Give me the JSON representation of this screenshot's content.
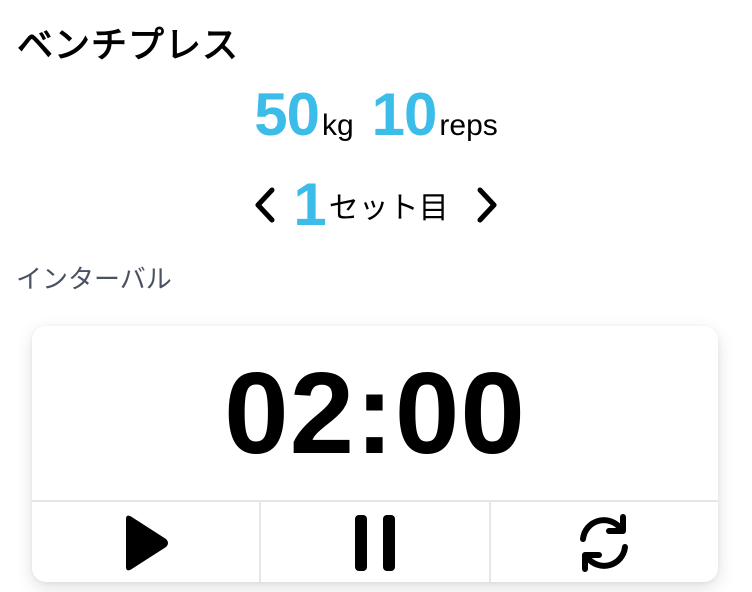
{
  "exercise": {
    "title": "ベンチプレス",
    "weight": "50",
    "weight_unit": "kg",
    "reps": "10",
    "reps_unit": "reps"
  },
  "set": {
    "number": "1",
    "label": "セット目",
    "prev_icon": "chevron-left-icon",
    "next_icon": "chevron-right-icon"
  },
  "interval": {
    "label": "インターバル",
    "time": "02:00"
  },
  "controls": {
    "play_icon": "play-icon",
    "pause_icon": "pause-icon",
    "reset_icon": "refresh-icon"
  },
  "colors": {
    "accent": "#3cbce8",
    "text": "#000000",
    "muted": "#4a5261",
    "divider": "#e6e6e6"
  }
}
